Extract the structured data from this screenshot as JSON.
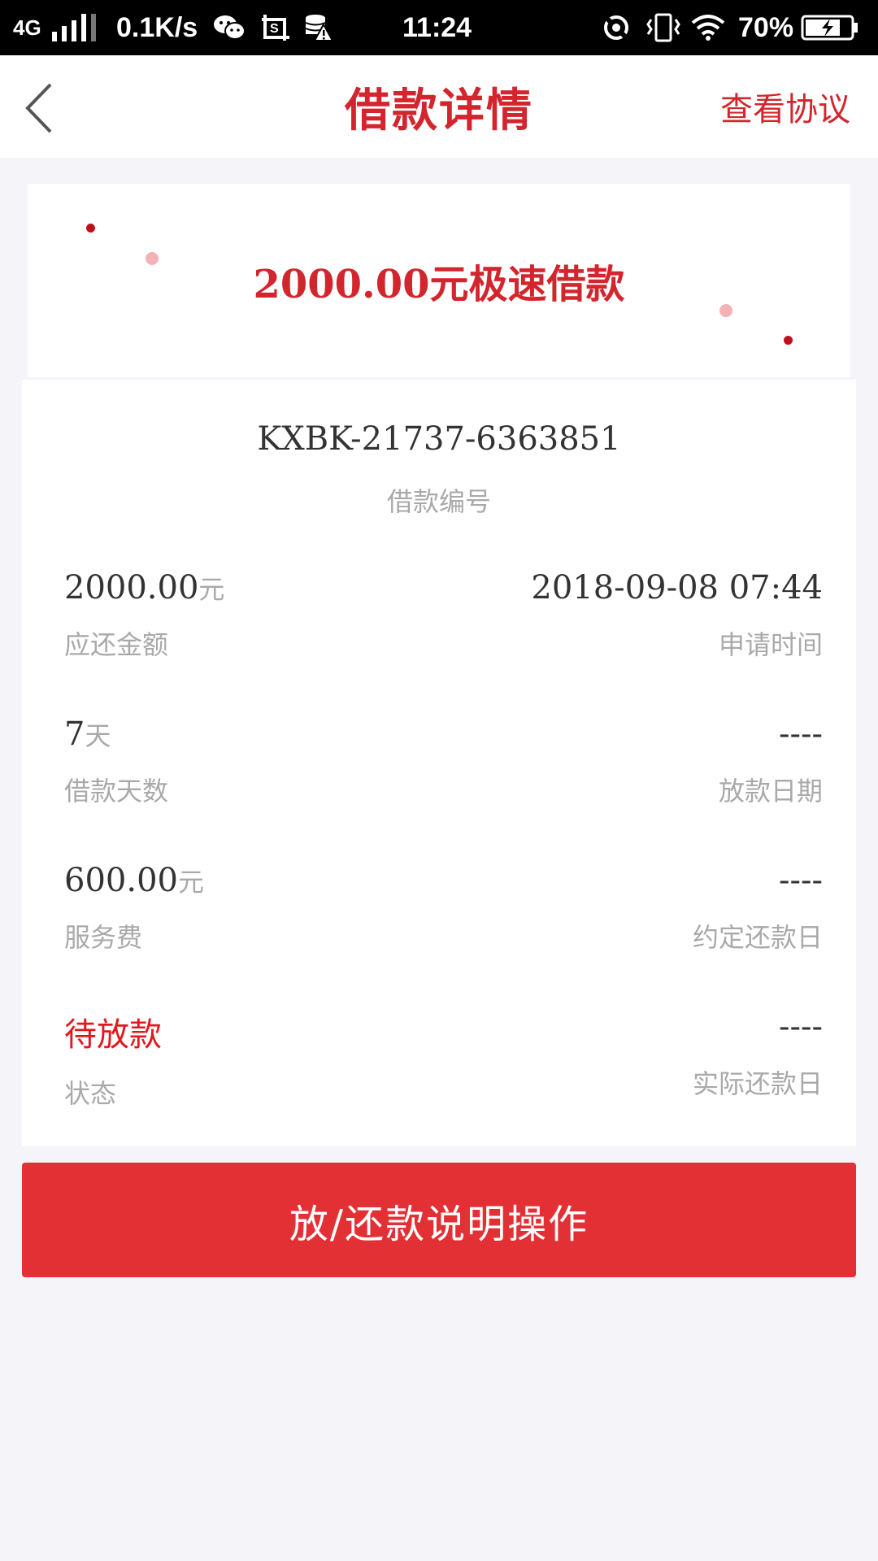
{
  "status_bar": {
    "network": "4G",
    "speed": "0.1K/s",
    "time": "11:24",
    "battery": "70%"
  },
  "nav": {
    "title": "借款详情",
    "right_link": "查看协议"
  },
  "banner": {
    "headline": "2000.00元极速借款"
  },
  "loan": {
    "number": "KXBK-21737-6363851",
    "number_label": "借款编号"
  },
  "details": {
    "repay_amount": {
      "value": "2000.00",
      "unit": "元",
      "label": "应还金额"
    },
    "apply_time": {
      "value": "2018-09-08 07:44",
      "label": "申请时间"
    },
    "loan_days": {
      "value": "7",
      "unit": "天",
      "label": "借款天数"
    },
    "disburse_date": {
      "value": "----",
      "label": "放款日期"
    },
    "service_fee": {
      "value": "600.00",
      "unit": "元",
      "label": "服务费"
    },
    "agreed_repay_date": {
      "value": "----",
      "label": "约定还款日"
    },
    "status": {
      "value": "待放款",
      "label": "状态"
    },
    "actual_repay_date": {
      "value": "----",
      "label": "实际还款日"
    }
  },
  "action": {
    "button_label": "放/还款说明操作"
  },
  "colors": {
    "brand_red": "#d3252d",
    "button_red": "#e33035",
    "status_red": "#e0191f",
    "label_gray": "#a9a9a9",
    "page_bg": "#f4f4f9"
  }
}
